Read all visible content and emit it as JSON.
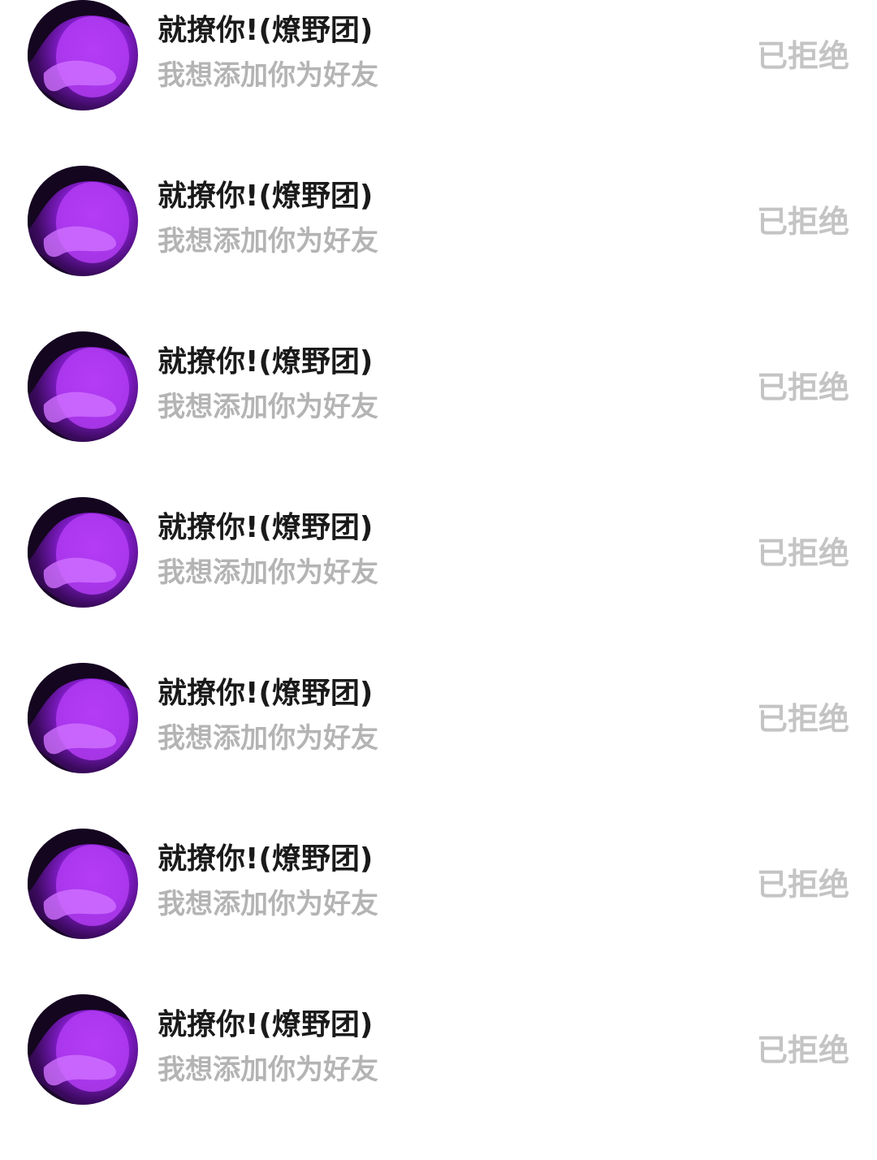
{
  "requests": [
    {
      "name": "就撩你!(燎野团)",
      "message": "我想添加你为好友",
      "status": "已拒绝"
    },
    {
      "name": "就撩你!(燎野团)",
      "message": "我想添加你为好友",
      "status": "已拒绝"
    },
    {
      "name": "就撩你!(燎野团)",
      "message": "我想添加你为好友",
      "status": "已拒绝"
    },
    {
      "name": "就撩你!(燎野团)",
      "message": "我想添加你为好友",
      "status": "已拒绝"
    },
    {
      "name": "就撩你!(燎野团)",
      "message": "我想添加你为好友",
      "status": "已拒绝"
    },
    {
      "name": "就撩你!(燎野团)",
      "message": "我想添加你为好友",
      "status": "已拒绝"
    },
    {
      "name": "就撩你!(燎野团)",
      "message": "我想添加你为好友",
      "status": "已拒绝"
    }
  ],
  "colors": {
    "name": "#1a1a1a",
    "message": "#b4b4b4",
    "status": "#c4c4c4",
    "avatar_tint": "#8a1fd6"
  }
}
